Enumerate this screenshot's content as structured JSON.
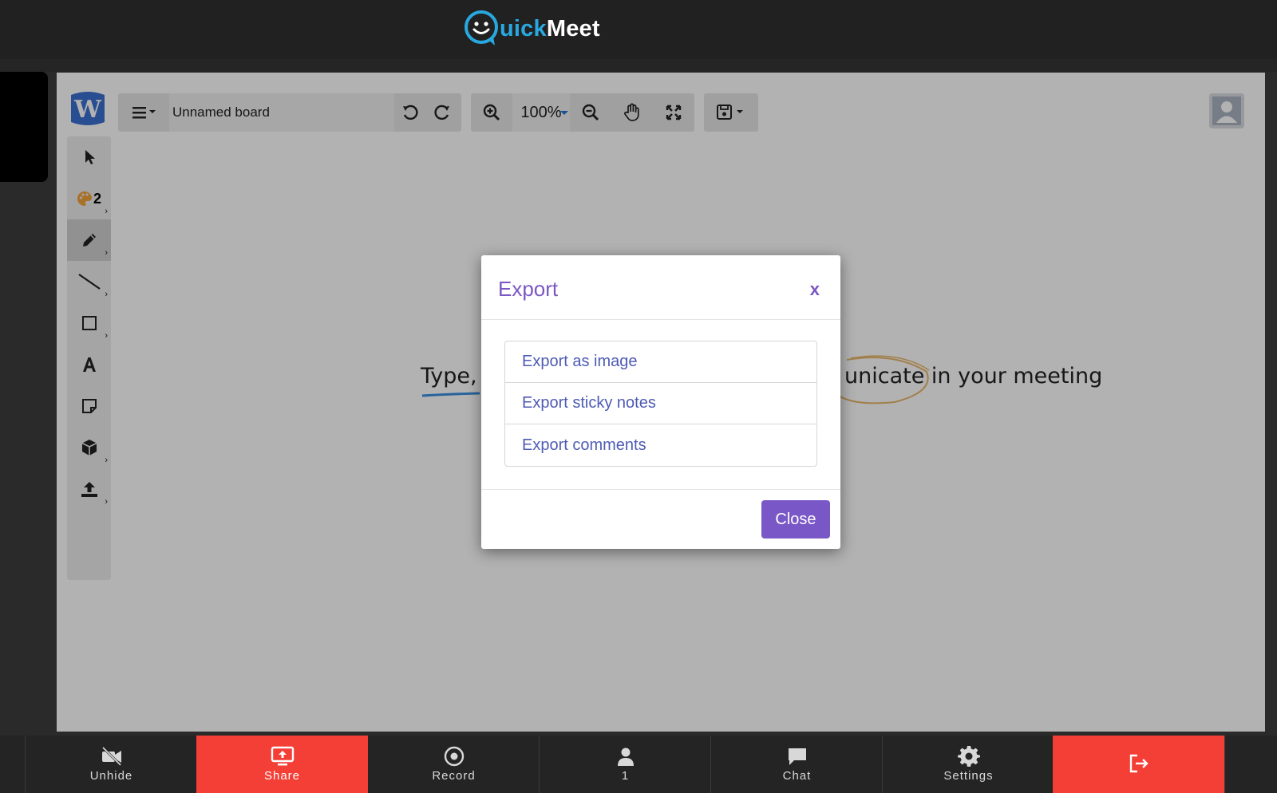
{
  "app": {
    "brand_part1": "uick",
    "brand_part2": "Meet",
    "brand_colors": {
      "accent": "#29a8e0",
      "text": "#ffffff"
    }
  },
  "whiteboard": {
    "board_name": "Unnamed board",
    "zoom": "100%",
    "canvas_text_left": "Type,",
    "canvas_text_right": "unicate in your meeting",
    "palette_badge": "2"
  },
  "modal": {
    "title": "Export",
    "close_x": "x",
    "options": [
      {
        "label": "Export as image"
      },
      {
        "label": "Export sticky notes"
      },
      {
        "label": "Export comments"
      }
    ],
    "close_button": "Close",
    "accent_color": "#7b57c2"
  },
  "bottom_bar": {
    "items": [
      {
        "label": "Unhide",
        "icon": "video-off-icon"
      },
      {
        "label": "Share",
        "icon": "screen-share-icon"
      },
      {
        "label": "Record",
        "icon": "record-icon"
      },
      {
        "label": "1",
        "icon": "person-icon"
      },
      {
        "label": "Chat",
        "icon": "chat-icon"
      },
      {
        "label": "Settings",
        "icon": "gear-icon"
      },
      {
        "label": "",
        "icon": "leave-icon"
      }
    ],
    "highlight_color": "#f43f36"
  }
}
